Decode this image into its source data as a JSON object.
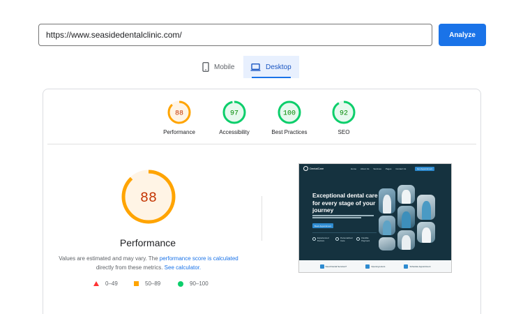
{
  "search": {
    "url": "https://www.seasidedentalclinic.com/",
    "analyze_label": "Analyze"
  },
  "tabs": {
    "mobile_label": "Mobile",
    "desktop_label": "Desktop",
    "selected": "Desktop"
  },
  "scores": [
    {
      "label": "Performance",
      "value": "88",
      "score": 88,
      "status": "average"
    },
    {
      "label": "Accessibility",
      "value": "97",
      "score": 97,
      "status": "pass"
    },
    {
      "label": "Best Practices",
      "value": "100",
      "score": 100,
      "status": "pass"
    },
    {
      "label": "SEO",
      "value": "92",
      "score": 92,
      "status": "pass"
    }
  ],
  "performance": {
    "score": "88",
    "title": "Performance",
    "desc_prefix": "Values are estimated and may vary. The ",
    "link1": "performance score is calculated",
    "desc_middle": " directly from these metrics. ",
    "link2": "See calculator."
  },
  "legend": {
    "fail": "0–49",
    "average": "50–89",
    "pass": "90–100"
  },
  "colors": {
    "accent": "#1a73e8",
    "pass": "#0cce6b",
    "pass_text": "#008800",
    "average": "#ffa400",
    "average_text": "#c33300",
    "fail": "#ff3333"
  },
  "icons": {
    "mobile": "phone-icon",
    "desktop": "laptop-icon"
  },
  "screenshot": {
    "brand": "DentalCare",
    "nav": [
      "Home",
      "About Us",
      "Services",
      "Pages",
      "Contact Us"
    ],
    "cta": "Get Appointment",
    "hero_title": "Exceptional dental care for every stage of your journey",
    "hero_button": "Book Appointment",
    "features": [
      "Experienced Doctors",
      "Personalized Care",
      "Flexible Payment"
    ],
    "bottom": [
      "Need Dental Services?",
      "Opening Hours",
      "Schedule Appointment"
    ]
  }
}
